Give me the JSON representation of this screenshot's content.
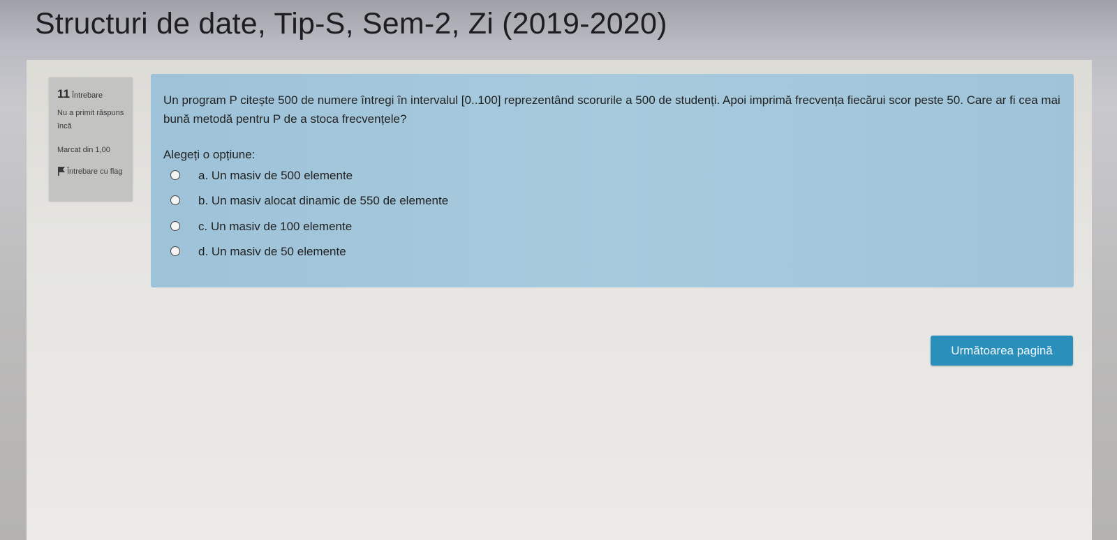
{
  "page": {
    "title": "Structuri de date, Tip-S, Sem-2, Zi (2019-2020)"
  },
  "question_info": {
    "number": "11",
    "number_word": "Întrebare",
    "state": "Nu a primit răspuns încă",
    "grade": "Marcat din 1,00",
    "flag_label": "Întrebare cu flag",
    "flag_icon": "flag-icon"
  },
  "question": {
    "text": "Un program P citește 500 de numere întregi în intervalul [0..100] reprezentând scorurile a 500 de studenți. Apoi imprimă frecvența fiecărui scor peste 50. Care ar fi cea mai bună metodă pentru P de a stoca frecvențele?",
    "prompt": "Alegeți o opțiune:",
    "options": [
      {
        "label": "a. Un masiv de 500 elemente"
      },
      {
        "label": "b. Un masiv alocat dinamic de 550 de elemente"
      },
      {
        "label": "c. Un masiv de 100 elemente"
      },
      {
        "label": "d. Un masiv de 50 elemente"
      }
    ]
  },
  "navigation": {
    "next_label": "Următoarea pagină"
  },
  "colors": {
    "question_bg": "#a7cadd",
    "info_bg": "#c3c3c1",
    "button_bg": "#2b8fbb"
  }
}
